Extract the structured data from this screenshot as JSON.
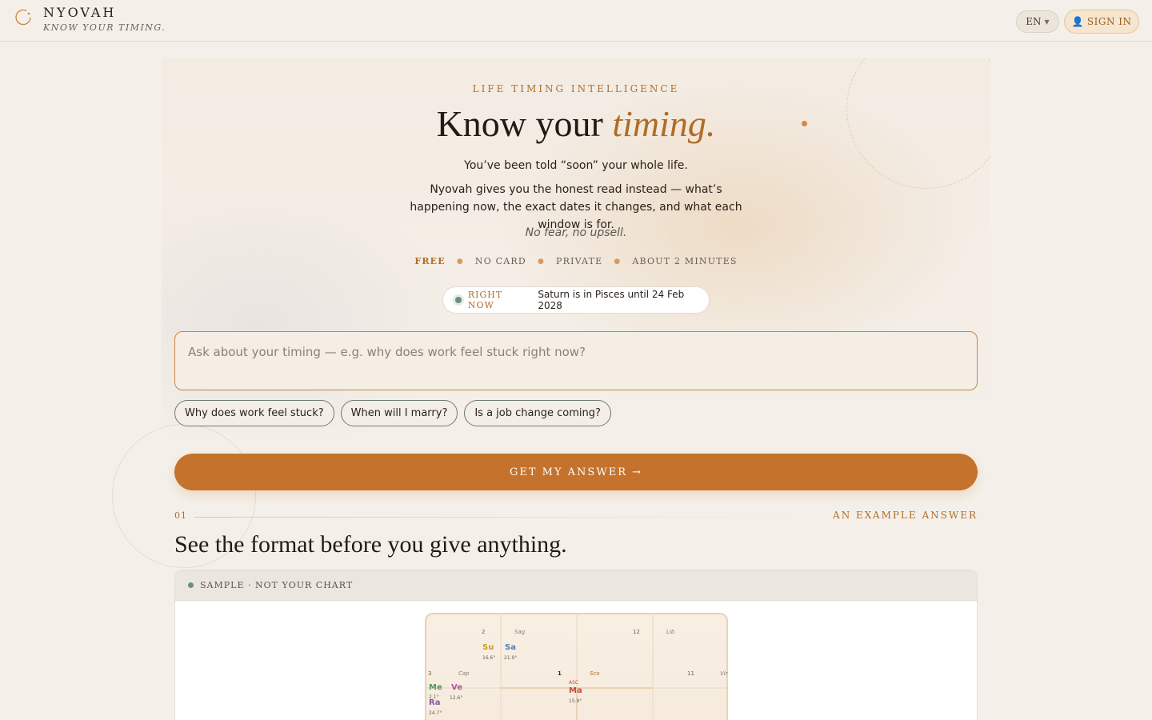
{
  "header": {
    "brand_name": "NYOVAH",
    "brand_tagline": "KNOW YOUR TIMING.",
    "lang_label": "EN",
    "signin_label": "SIGN IN"
  },
  "hero": {
    "eyebrow": "LIFE TIMING INTELLIGENCE",
    "title_plain": "Know your",
    "title_accent": "timing.",
    "line1": "You’ve been told “soon” your whole life.",
    "para": "Nyovah gives you the honest read instead — what’s happening now, the exact dates it changes, and what each window is for.",
    "italic": "No fear, no upsell.",
    "badges": [
      "FREE",
      "NO CARD",
      "PRIVATE",
      "ABOUT 2 MINUTES"
    ],
    "now_label": "RIGHT NOW",
    "now_text": "Saturn is in Pisces until 24 Feb 2028"
  },
  "ask": {
    "placeholder": "Ask about your timing — e.g. why does work feel stuck right now?",
    "value": ""
  },
  "suggestions": [
    "Why does work feel stuck?",
    "When will I marry?",
    "Is a job change coming?"
  ],
  "cta_label": "GET MY ANSWER →",
  "section": {
    "number": "01",
    "label": "AN EXAMPLE ANSWER",
    "title": "See the format before you give anything.",
    "sample_tag": "SAMPLE · NOT YOUR CHART"
  },
  "chart": {
    "houses": {
      "h2": "2",
      "h12": "12",
      "h3": "3",
      "h1": "1",
      "h11": "11"
    },
    "signs": {
      "sag": "Sag",
      "lib": "Lib",
      "cap": "Cap",
      "sco": "Sco",
      "vir": "Vir"
    },
    "asc_label": "ASC",
    "planets": [
      {
        "abbr": "Su",
        "deg": "16.6°",
        "color": "#d2962a"
      },
      {
        "abbr": "Sa",
        "deg": "21.9°",
        "color": "#4e7db8"
      },
      {
        "abbr": "Me",
        "deg": "2.1°",
        "color": "#4f9a5f"
      },
      {
        "abbr": "Ve",
        "deg": "12.6°",
        "color": "#b0569a"
      },
      {
        "abbr": "Ra",
        "deg": "24.7°",
        "color": "#7c5aa6"
      },
      {
        "abbr": "Ma",
        "deg": "15.9°",
        "color": "#c8473a"
      }
    ]
  },
  "colors": {
    "accent": "#c4722c",
    "accent_text": "#b06c25",
    "background": "#f4f0e9"
  }
}
